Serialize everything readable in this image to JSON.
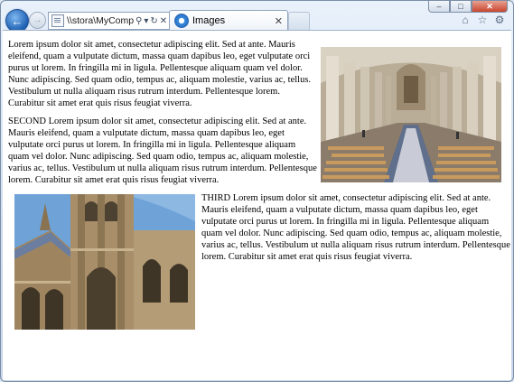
{
  "window": {
    "caption_buttons": {
      "minimize": "–",
      "maximize": "□",
      "close": "✕"
    }
  },
  "nav": {
    "back_icon": "back-arrow-icon",
    "forward_icon": "forward-arrow-icon",
    "address_url": "\\\\stora\\MyComput",
    "address_search_icon": "search-icon",
    "address_refresh_icon": "refresh-icon",
    "address_stop_icon": "stop-icon"
  },
  "tab": {
    "title": "Images",
    "close": "✕"
  },
  "toolbar_icons": [
    "home-icon",
    "favorites-star-icon",
    "gear-icon"
  ],
  "content": {
    "paragraph1": "Lorem ipsum dolor sit amet, consectetur adipiscing elit. Sed at ante. Mauris eleifend, quam a vulputate dictum, massa quam dapibus leo, eget vulputate orci purus ut lorem. In fringilla mi in ligula. Pellentesque aliquam quam vel dolor. Nunc adipiscing. Sed quam odio, tempus ac, aliquam molestie, varius ac, tellus. Vestibulum ut nulla aliquam risus rutrum interdum. Pellentesque lorem. Curabitur sit amet erat quis risus feugiat viverra.",
    "paragraph2": "SECOND Lorem ipsum dolor sit amet, consectetur adipiscing elit. Sed at ante. Mauris eleifend, quam a vulputate dictum, massa quam dapibus leo, eget vulputate orci purus ut lorem. In fringilla mi in ligula. Pellentesque aliquam quam vel dolor. Nunc adipiscing. Sed quam odio, tempus ac, aliquam molestie, varius ac, tellus. Vestibulum ut nulla aliquam risus rutrum interdum. Pellentesque lorem. Curabitur sit amet erat quis risus feugiat viverra.",
    "paragraph3": "THIRD Lorem ipsum dolor sit amet, consectetur adipiscing elit. Sed at ante. Mauris eleifend, quam a vulputate dictum, massa quam dapibus leo, eget vulputate orci purus ut lorem. In fringilla mi in ligula. Pellentesque aliquam quam vel dolor. Nunc adipiscing. Sed quam odio, tempus ac, aliquam molestie, varius ac, tellus. Vestibulum ut nulla aliquam risus rutrum interdum. Pellentesque lorem. Curabitur sit amet erat quis risus feugiat viverra."
  }
}
